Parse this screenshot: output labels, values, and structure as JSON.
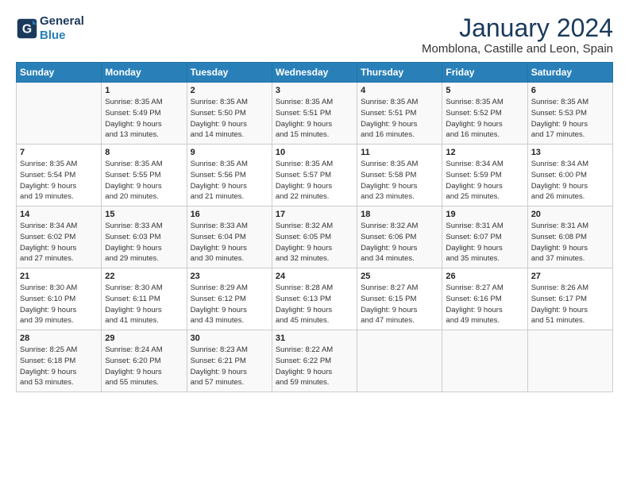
{
  "header": {
    "logo_line1": "General",
    "logo_line2": "Blue",
    "title": "January 2024",
    "subtitle": "Momblona, Castille and Leon, Spain"
  },
  "days_header": [
    "Sunday",
    "Monday",
    "Tuesday",
    "Wednesday",
    "Thursday",
    "Friday",
    "Saturday"
  ],
  "weeks": [
    [
      {
        "num": "",
        "info": ""
      },
      {
        "num": "1",
        "info": "Sunrise: 8:35 AM\nSunset: 5:49 PM\nDaylight: 9 hours\nand 13 minutes."
      },
      {
        "num": "2",
        "info": "Sunrise: 8:35 AM\nSunset: 5:50 PM\nDaylight: 9 hours\nand 14 minutes."
      },
      {
        "num": "3",
        "info": "Sunrise: 8:35 AM\nSunset: 5:51 PM\nDaylight: 9 hours\nand 15 minutes."
      },
      {
        "num": "4",
        "info": "Sunrise: 8:35 AM\nSunset: 5:51 PM\nDaylight: 9 hours\nand 16 minutes."
      },
      {
        "num": "5",
        "info": "Sunrise: 8:35 AM\nSunset: 5:52 PM\nDaylight: 9 hours\nand 16 minutes."
      },
      {
        "num": "6",
        "info": "Sunrise: 8:35 AM\nSunset: 5:53 PM\nDaylight: 9 hours\nand 17 minutes."
      }
    ],
    [
      {
        "num": "7",
        "info": "Sunrise: 8:35 AM\nSunset: 5:54 PM\nDaylight: 9 hours\nand 19 minutes."
      },
      {
        "num": "8",
        "info": "Sunrise: 8:35 AM\nSunset: 5:55 PM\nDaylight: 9 hours\nand 20 minutes."
      },
      {
        "num": "9",
        "info": "Sunrise: 8:35 AM\nSunset: 5:56 PM\nDaylight: 9 hours\nand 21 minutes."
      },
      {
        "num": "10",
        "info": "Sunrise: 8:35 AM\nSunset: 5:57 PM\nDaylight: 9 hours\nand 22 minutes."
      },
      {
        "num": "11",
        "info": "Sunrise: 8:35 AM\nSunset: 5:58 PM\nDaylight: 9 hours\nand 23 minutes."
      },
      {
        "num": "12",
        "info": "Sunrise: 8:34 AM\nSunset: 5:59 PM\nDaylight: 9 hours\nand 25 minutes."
      },
      {
        "num": "13",
        "info": "Sunrise: 8:34 AM\nSunset: 6:00 PM\nDaylight: 9 hours\nand 26 minutes."
      }
    ],
    [
      {
        "num": "14",
        "info": "Sunrise: 8:34 AM\nSunset: 6:02 PM\nDaylight: 9 hours\nand 27 minutes."
      },
      {
        "num": "15",
        "info": "Sunrise: 8:33 AM\nSunset: 6:03 PM\nDaylight: 9 hours\nand 29 minutes."
      },
      {
        "num": "16",
        "info": "Sunrise: 8:33 AM\nSunset: 6:04 PM\nDaylight: 9 hours\nand 30 minutes."
      },
      {
        "num": "17",
        "info": "Sunrise: 8:32 AM\nSunset: 6:05 PM\nDaylight: 9 hours\nand 32 minutes."
      },
      {
        "num": "18",
        "info": "Sunrise: 8:32 AM\nSunset: 6:06 PM\nDaylight: 9 hours\nand 34 minutes."
      },
      {
        "num": "19",
        "info": "Sunrise: 8:31 AM\nSunset: 6:07 PM\nDaylight: 9 hours\nand 35 minutes."
      },
      {
        "num": "20",
        "info": "Sunrise: 8:31 AM\nSunset: 6:08 PM\nDaylight: 9 hours\nand 37 minutes."
      }
    ],
    [
      {
        "num": "21",
        "info": "Sunrise: 8:30 AM\nSunset: 6:10 PM\nDaylight: 9 hours\nand 39 minutes."
      },
      {
        "num": "22",
        "info": "Sunrise: 8:30 AM\nSunset: 6:11 PM\nDaylight: 9 hours\nand 41 minutes."
      },
      {
        "num": "23",
        "info": "Sunrise: 8:29 AM\nSunset: 6:12 PM\nDaylight: 9 hours\nand 43 minutes."
      },
      {
        "num": "24",
        "info": "Sunrise: 8:28 AM\nSunset: 6:13 PM\nDaylight: 9 hours\nand 45 minutes."
      },
      {
        "num": "25",
        "info": "Sunrise: 8:27 AM\nSunset: 6:15 PM\nDaylight: 9 hours\nand 47 minutes."
      },
      {
        "num": "26",
        "info": "Sunrise: 8:27 AM\nSunset: 6:16 PM\nDaylight: 9 hours\nand 49 minutes."
      },
      {
        "num": "27",
        "info": "Sunrise: 8:26 AM\nSunset: 6:17 PM\nDaylight: 9 hours\nand 51 minutes."
      }
    ],
    [
      {
        "num": "28",
        "info": "Sunrise: 8:25 AM\nSunset: 6:18 PM\nDaylight: 9 hours\nand 53 minutes."
      },
      {
        "num": "29",
        "info": "Sunrise: 8:24 AM\nSunset: 6:20 PM\nDaylight: 9 hours\nand 55 minutes."
      },
      {
        "num": "30",
        "info": "Sunrise: 8:23 AM\nSunset: 6:21 PM\nDaylight: 9 hours\nand 57 minutes."
      },
      {
        "num": "31",
        "info": "Sunrise: 8:22 AM\nSunset: 6:22 PM\nDaylight: 9 hours\nand 59 minutes."
      },
      {
        "num": "",
        "info": ""
      },
      {
        "num": "",
        "info": ""
      },
      {
        "num": "",
        "info": ""
      }
    ]
  ]
}
